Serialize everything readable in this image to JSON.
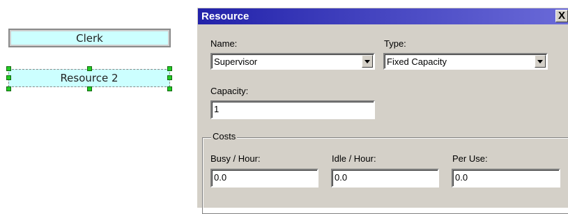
{
  "canvas": {
    "shape1_label": "Clerk",
    "shape2_label": "Resource 2",
    "shape_fill": "#ccffff",
    "handle_color": "#22cc22"
  },
  "dialog": {
    "title": "Resource",
    "close_glyph": "X",
    "name_label": "Name:",
    "name_value": "Supervisor",
    "type_label": "Type:",
    "type_value": "Fixed Capacity",
    "capacity_label": "Capacity:",
    "capacity_value": "1",
    "costs_legend": "Costs",
    "busy_label": "Busy / Hour:",
    "busy_value": "0.0",
    "idle_label": "Idle / Hour:",
    "idle_value": "0.0",
    "peruse_label": "Per Use:",
    "peruse_value": "0.0",
    "titlebar_color": "#2222aa"
  }
}
